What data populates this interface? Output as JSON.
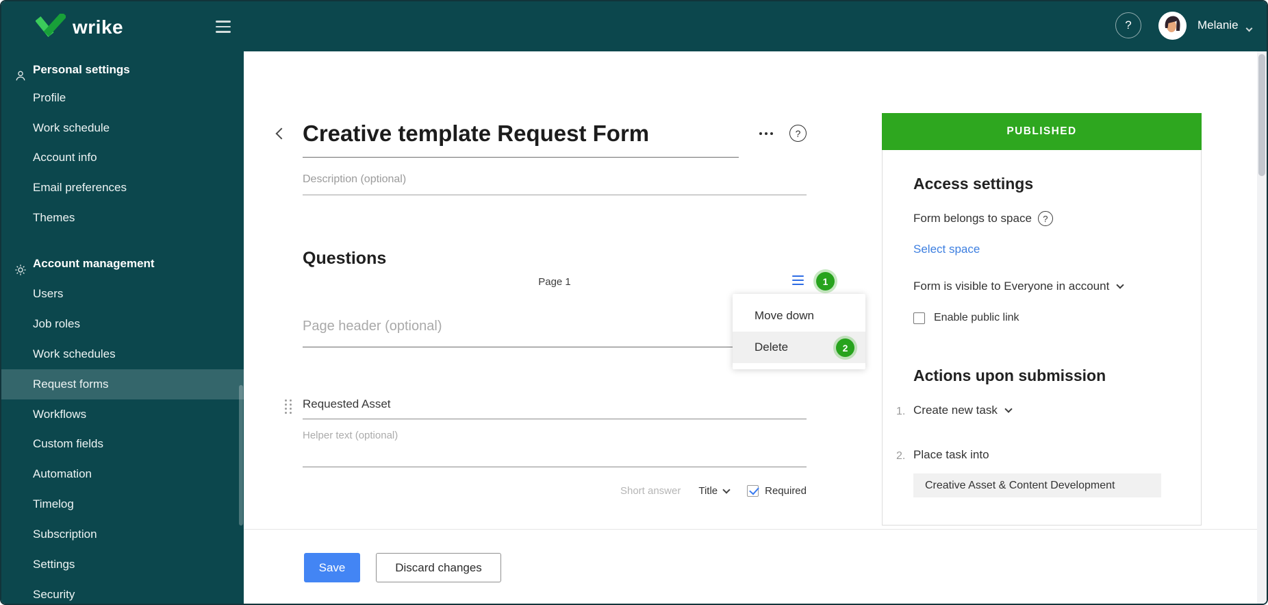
{
  "topbar": {
    "logo": "wrike",
    "help": "?",
    "user": "Melanie"
  },
  "sidebar": {
    "sections": [
      {
        "label": "Personal settings",
        "icon": "person-icon",
        "items": [
          {
            "label": "Profile"
          },
          {
            "label": "Work schedule"
          },
          {
            "label": "Account info"
          },
          {
            "label": "Email preferences"
          },
          {
            "label": "Themes"
          }
        ]
      },
      {
        "label": "Account management",
        "icon": "gear-icon",
        "items": [
          {
            "label": "Users"
          },
          {
            "label": "Job roles"
          },
          {
            "label": "Work schedules"
          },
          {
            "label": "Request forms",
            "selected": true
          },
          {
            "label": "Workflows"
          },
          {
            "label": "Custom fields"
          },
          {
            "label": "Automation"
          },
          {
            "label": "Timelog"
          },
          {
            "label": "Subscription"
          },
          {
            "label": "Settings"
          },
          {
            "label": "Security"
          }
        ]
      }
    ]
  },
  "form": {
    "title": "Creative template Request Form",
    "help": "?",
    "description_placeholder": "Description (optional)",
    "questions_heading": "Questions",
    "page_label": "Page 1",
    "page_header_placeholder": "Page header (optional)",
    "question": {
      "label": "Requested Asset",
      "helper_placeholder": "Helper text (optional)",
      "type": "Short answer",
      "mapping": "Title",
      "required_label": "Required",
      "required_checked": true
    }
  },
  "context_menu": {
    "items": [
      {
        "label": "Move down"
      },
      {
        "label": "Delete",
        "highlighted": true
      }
    ]
  },
  "callouts": {
    "one": "1",
    "two": "2"
  },
  "panel": {
    "status": "PUBLISHED",
    "access_heading": "Access settings",
    "space_label": "Form belongs to space",
    "space_help": "?",
    "select_space": "Select space",
    "visibility": "Form is visible to Everyone in account",
    "public_link": "Enable public link",
    "public_link_checked": false,
    "actions_heading": "Actions upon submission",
    "actions": [
      {
        "num": "1.",
        "label": "Create new task",
        "dropdown": true
      },
      {
        "num": "2.",
        "label": "Place task into",
        "dropdown": false
      }
    ],
    "task_destination": "Creative Asset & Content Development"
  },
  "footer": {
    "save": "Save",
    "discard": "Discard changes"
  },
  "colors": {
    "teal": "#0C474D",
    "published_green": "#2EA71F",
    "badge_green": "#27A31D",
    "save_blue": "#4385F4",
    "link_blue": "#3D7FE0",
    "menu_icon_blue": "#2E6CE4"
  }
}
